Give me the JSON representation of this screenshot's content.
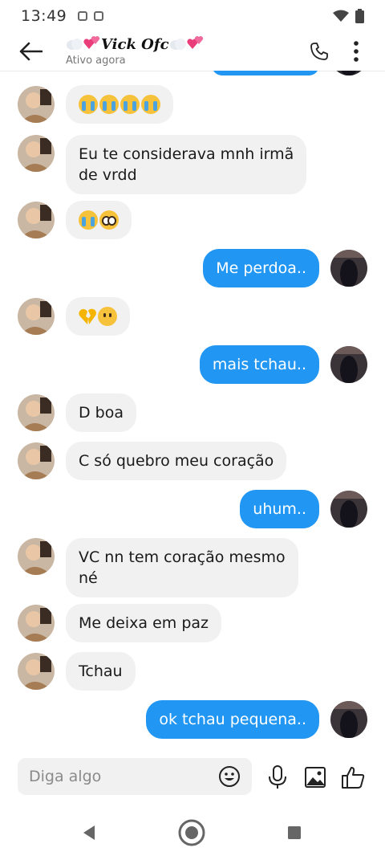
{
  "status_bar": {
    "time": "13:49"
  },
  "header": {
    "contact_name": "Vick Ofc",
    "status": "Ativo agora"
  },
  "messages": [
    {
      "side": "in",
      "text": "",
      "emoji": "crying-face x4"
    },
    {
      "side": "in",
      "lines": [
        "Eu te considerava mnh irmã",
        "de vrdd"
      ]
    },
    {
      "side": "in",
      "text": "",
      "emoji": "crying-face, pleading-face"
    },
    {
      "side": "out",
      "text": "Me perdoa.."
    },
    {
      "side": "in",
      "text": "",
      "emoji": "broken-heart, confused-face"
    },
    {
      "side": "out",
      "text": "mais tchau.."
    },
    {
      "side": "in",
      "text": "D boa"
    },
    {
      "side": "in",
      "text": "C só quebro meu coração"
    },
    {
      "side": "out",
      "text": "uhum.."
    },
    {
      "side": "in",
      "lines": [
        "VC nn tem coração mesmo",
        "né"
      ]
    },
    {
      "side": "in",
      "text": "Me deixa em paz"
    },
    {
      "side": "in",
      "text": "Tchau"
    },
    {
      "side": "out",
      "text": "ok tchau pequena.."
    }
  ],
  "composer": {
    "placeholder": "Diga algo"
  },
  "colors": {
    "accent": "#2196f3",
    "incoming_bubble": "#f1f1f1",
    "text_dark": "#1a1a1a"
  },
  "icons": [
    "back-arrow-icon",
    "phone-icon",
    "more-vert-icon",
    "emoji-icon",
    "microphone-icon",
    "image-icon",
    "thumbs-up-icon",
    "nav-back-icon",
    "nav-home-icon",
    "nav-recents-icon"
  ]
}
